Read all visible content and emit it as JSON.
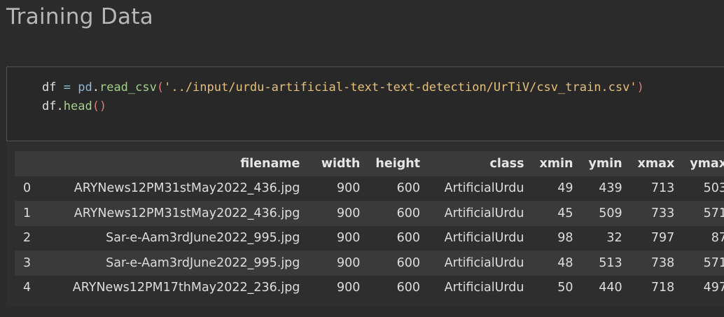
{
  "heading": "Training Data",
  "code": {
    "line1": {
      "var": "df",
      "op": "=",
      "module": "pd",
      "dot": ".",
      "func": "read_csv",
      "open_paren": "(",
      "string": "'../input/urdu-artificial-text-text-detection/UrTiV/csv_train.csv'",
      "close_paren": ")"
    },
    "line2": {
      "var": "df",
      "dot": ".",
      "func": "head",
      "parens": "()"
    }
  },
  "table": {
    "columns": [
      "",
      "filename",
      "width",
      "height",
      "class",
      "xmin",
      "ymin",
      "xmax",
      "ymax"
    ],
    "rows": [
      [
        "0",
        "ARYNews12PM31stMay2022_436.jpg",
        "900",
        "600",
        "ArtificialUrdu",
        "49",
        "439",
        "713",
        "503"
      ],
      [
        "1",
        "ARYNews12PM31stMay2022_436.jpg",
        "900",
        "600",
        "ArtificialUrdu",
        "45",
        "509",
        "733",
        "571"
      ],
      [
        "2",
        "Sar-e-Aam3rdJune2022_995.jpg",
        "900",
        "600",
        "ArtificialUrdu",
        "98",
        "32",
        "797",
        "87"
      ],
      [
        "3",
        "Sar-e-Aam3rdJune2022_995.jpg",
        "900",
        "600",
        "ArtificialUrdu",
        "48",
        "513",
        "738",
        "571"
      ],
      [
        "4",
        "ARYNews12PM17thMay2022_236.jpg",
        "900",
        "600",
        "ArtificialUrdu",
        "50",
        "440",
        "718",
        "497"
      ]
    ]
  }
}
